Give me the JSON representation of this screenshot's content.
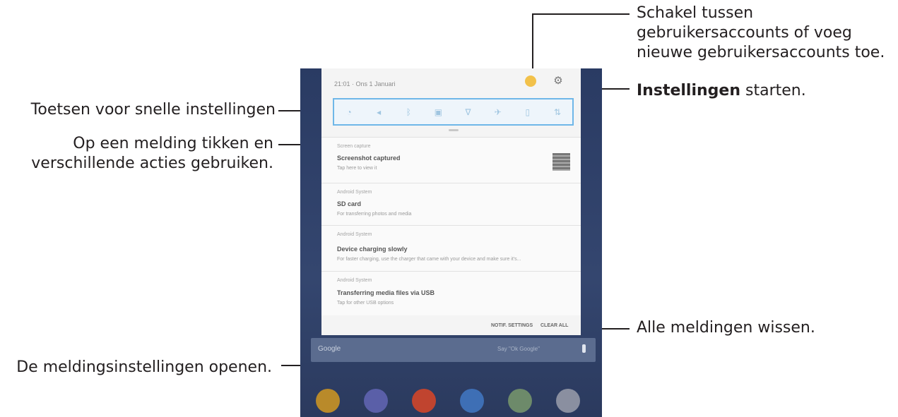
{
  "callouts": {
    "switch_accounts": "Schakel tussen\ngebruikersaccounts of voeg\nnieuwe gebruikersaccounts toe.",
    "settings_bold": "Instellingen",
    "settings_rest": " starten.",
    "quick_settings": "Toetsen voor snelle instellingen",
    "notification_tap": "Op een melding tikken en\nverschillende acties gebruiken.",
    "clear_all": "Alle meldingen wissen.",
    "notif_settings": "De meldingsinstellingen openen."
  },
  "device": {
    "status_time": "21:01 · Ons 1 Januari",
    "notifications": [
      {
        "app": "Screen capture",
        "title": "Screenshot captured",
        "body": "Tap here to view it"
      },
      {
        "app": "Android System",
        "title": "SD card",
        "body": "For transferring photos and media"
      },
      {
        "app": "Android System",
        "title": "Device charging slowly",
        "body": "For faster charging, use the charger that came with your device and make sure it's..."
      },
      {
        "app": "Android System",
        "title": "Transferring media files via USB",
        "body": "Tap for other USB options"
      }
    ],
    "actions": {
      "notif_settings": "NOTIF. SETTINGS",
      "clear_all": "CLEAR ALL"
    },
    "search_label": "Google",
    "search_hint": "Say \"Ok Google\""
  },
  "colors": {
    "qs_border": "#6fb7e8",
    "avatar": "#f2c14a",
    "tablet_bg": "#2c3e6b"
  }
}
